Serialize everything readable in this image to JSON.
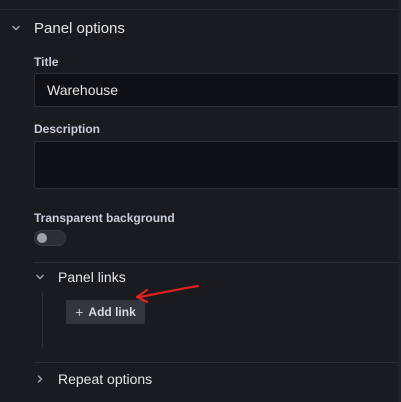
{
  "panel_options": {
    "title": "Panel options",
    "title_label": "Title",
    "title_value": "Warehouse",
    "description_label": "Description",
    "description_value": "",
    "transparent_label": "Transparent background",
    "transparent_enabled": false
  },
  "panel_links": {
    "title": "Panel links",
    "add_link_label": "Add link"
  },
  "repeat_options": {
    "title": "Repeat options"
  },
  "colors": {
    "background": "#1a1b1f",
    "input_bg": "#0f1014",
    "annotation_arrow": "#e01f1f"
  },
  "icons": {
    "panel_options_chevron": "chevron-down-icon",
    "panel_links_chevron": "chevron-down-icon",
    "repeat_chevron": "chevron-right-icon",
    "add_link": "plus-icon"
  }
}
